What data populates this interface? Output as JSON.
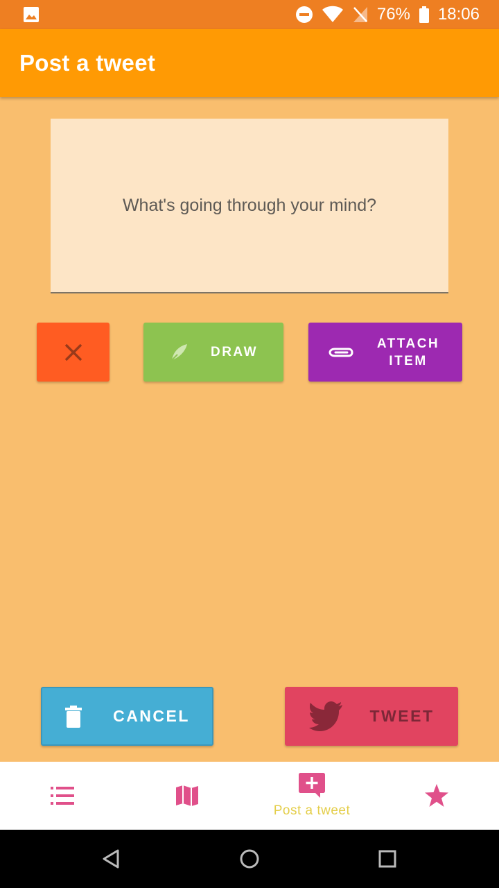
{
  "status_bar": {
    "battery": "76%",
    "time": "18:06"
  },
  "app_bar": {
    "title": "Post a tweet"
  },
  "compose": {
    "placeholder": "What's going through your mind?"
  },
  "actions": {
    "draw_label": "DRAW",
    "attach_label_line1": "ATTACH",
    "attach_label_line2": "ITEM"
  },
  "footer_buttons": {
    "cancel_label": "CANCEL",
    "tweet_label": "TWEET"
  },
  "bottom_nav": {
    "items": [
      {
        "icon": "list-icon"
      },
      {
        "icon": "map-icon"
      },
      {
        "icon": "add-post-icon",
        "label": "Post a tweet",
        "active": true
      },
      {
        "icon": "star-icon"
      }
    ]
  },
  "colors": {
    "status_bar": "#ee7f22",
    "app_bar": "#ff9a04",
    "background": "#f9be6e",
    "compose_box": "#fde5c6",
    "close_button": "#ff5c22",
    "draw_button": "#8dc350",
    "attach_button": "#9d29b1",
    "cancel_button": "#45aed4",
    "tweet_button": "#e14460",
    "nav_icon": "#e0508a",
    "nav_active_label": "#e4ce4a"
  }
}
